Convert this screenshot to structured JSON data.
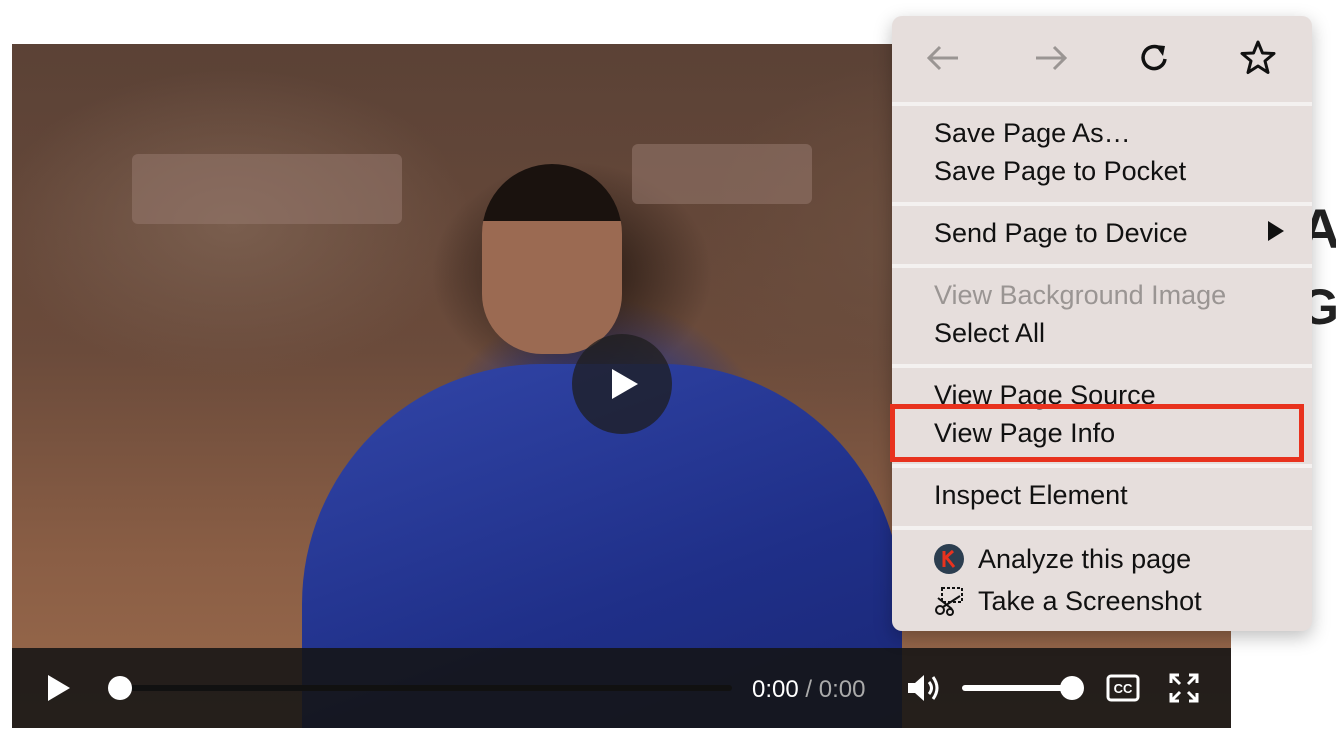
{
  "background_text": {
    "heading_1": "Ac",
    "heading_2": "Ge"
  },
  "video": {
    "current_time": "0:00",
    "separator": " / ",
    "duration": "0:00",
    "progress_fraction": 0,
    "volume_fraction": 1
  },
  "context_menu": {
    "nav": {
      "back_icon": "arrow-left-icon",
      "forward_icon": "arrow-right-icon",
      "reload_icon": "reload-icon",
      "bookmark_icon": "star-icon"
    },
    "items": {
      "save_page_as": "Save Page As…",
      "save_to_pocket": "Save Page to Pocket",
      "send_to_device": "Send Page to Device",
      "view_background_image": "View Background Image",
      "select_all": "Select All",
      "view_page_source": "View Page Source",
      "view_page_info": "View Page Info",
      "inspect_element": "Inspect Element",
      "analyze_page": "Analyze this page",
      "take_screenshot": "Take a Screenshot"
    },
    "highlighted_item": "View Page Info",
    "highlight_color": "#e8321e"
  }
}
